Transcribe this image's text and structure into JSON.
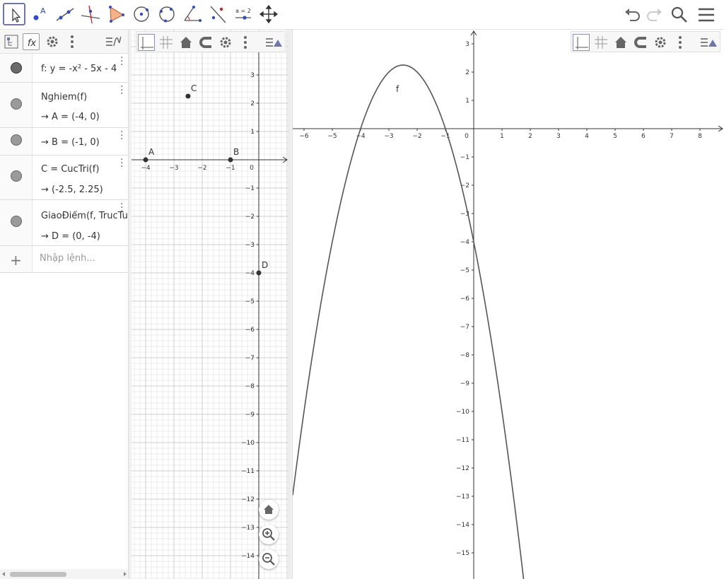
{
  "toolbar": {
    "tools": [
      {
        "name": "move-tool-icon"
      },
      {
        "name": "point-tool-icon"
      },
      {
        "name": "line-tool-icon"
      },
      {
        "name": "perpendicular-line-tool-icon"
      },
      {
        "name": "polygon-tool-icon"
      },
      {
        "name": "circle-center-point-tool-icon"
      },
      {
        "name": "circle-three-points-tool-icon"
      },
      {
        "name": "angle-tool-icon"
      },
      {
        "name": "reflect-tool-icon"
      },
      {
        "name": "slider-tool-icon",
        "label": "a = 2"
      },
      {
        "name": "move-graphics-view-tool-icon"
      }
    ],
    "right": [
      "undo-icon",
      "redo-icon",
      "search-icon",
      "menu-icon"
    ]
  },
  "algebra": {
    "header_icons": [
      "algebra-view-icon",
      "fx-icon",
      "gear-icon",
      "more-vert-icon",
      "algebra-style-icon"
    ],
    "rows": [
      {
        "line1": "f: y = -x² - 5x - 4",
        "line2": "",
        "marble": "filled"
      },
      {
        "line1": "Nghiem(f)",
        "line2": "→  A = (-4, 0)",
        "marble": "empty"
      },
      {
        "line1": "→  B = (-1, 0)",
        "line2": "",
        "marble": "empty"
      },
      {
        "line1": "C = CucTri(f)",
        "line2": "→  (-2.5, 2.25)",
        "marble": "empty"
      },
      {
        "line1": "GiaoĐiểm(f, TrucTung",
        "line2": "→  D = (0, -4)",
        "marble": "empty"
      }
    ],
    "input_placeholder": "Nhập lệnh..."
  },
  "graphics1": {
    "x_ticks": [
      "−4",
      "−3",
      "−2",
      "−1",
      "0"
    ],
    "y_ticks": [
      "3",
      "2",
      "1",
      "−1",
      "−2",
      "−3",
      "−4",
      "−5",
      "−6",
      "−7",
      "−8",
      "−9",
      "−10",
      "−11",
      "−12",
      "−13",
      "−14"
    ],
    "points": [
      {
        "label": "A",
        "x": -4,
        "y": 0
      },
      {
        "label": "B",
        "x": -1,
        "y": 0
      },
      {
        "label": "C",
        "x": -2.5,
        "y": 2.25
      },
      {
        "label": "D",
        "x": 0,
        "y": -4
      }
    ],
    "zoom_buttons": [
      "home-icon",
      "zoom-in-icon",
      "zoom-out-icon"
    ]
  },
  "graphics2": {
    "x_ticks": [
      "−6",
      "−5",
      "−4",
      "−3",
      "−2",
      "−1",
      "0",
      "1",
      "2",
      "3",
      "4",
      "5",
      "6",
      "7",
      "8"
    ],
    "y_ticks": [
      "3",
      "2",
      "1",
      "−1",
      "−2",
      "−3",
      "−4",
      "−5",
      "−6",
      "−7",
      "−8",
      "−9",
      "−10",
      "−11",
      "−12",
      "−13",
      "−14",
      "−15"
    ],
    "curve_label": "f",
    "function": {
      "a": -1,
      "b": -5,
      "c": -4
    }
  },
  "style_bar_icons": [
    "axes-icon",
    "grid-icon",
    "home-icon",
    "magnet-icon",
    "gear-icon",
    "more-vert-icon",
    "view-style-icon"
  ],
  "colors": {
    "accent": "#6f75b0",
    "curve": "#555555",
    "point": "#333333",
    "grid_major": "#cfcfcf",
    "grid_minor": "#ececec"
  }
}
